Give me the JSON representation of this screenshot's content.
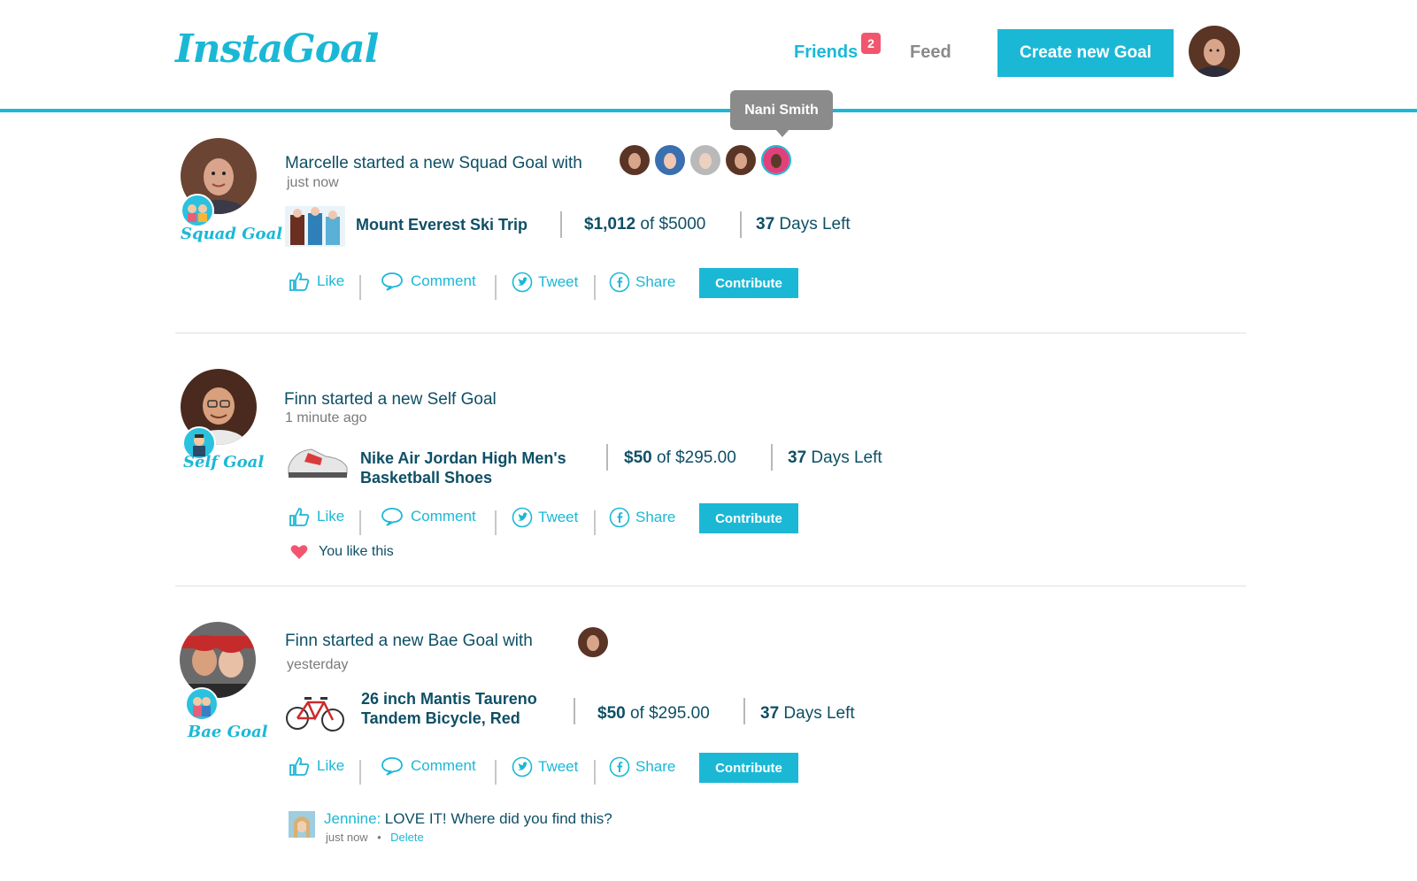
{
  "app": {
    "logo": "InstaGoal"
  },
  "nav": {
    "friends_label": "Friends",
    "friends_badge": "2",
    "feed_label": "Feed",
    "create_label": "Create new Goal",
    "tooltip_name": "Nani Smith"
  },
  "colors": {
    "accent": "#1bb8d6",
    "badge": "#f2566f",
    "text": "#0e4f66",
    "muted": "#7a7a7a"
  },
  "actions": {
    "like": "Like",
    "comment": "Comment",
    "tweet": "Tweet",
    "share": "Share",
    "contribute": "Contribute"
  },
  "posts": [
    {
      "title": "Marcelle started a new Squad Goal with",
      "time": "just now",
      "type_label": "Squad Goal",
      "goal_name": "Mount Everest Ski Trip",
      "raised": "$1,012",
      "of_text": "of $5000",
      "days": "37",
      "days_label": "Days Left"
    },
    {
      "title": "Finn started a new Self Goal",
      "time": "1 minute ago",
      "type_label": "Self Goal",
      "goal_name_line1": "Nike Air Jordan High Men's",
      "goal_name_line2": "Basketball Shoes",
      "raised": "$50",
      "of_text": "of $295.00",
      "days": "37",
      "days_label": "Days Left",
      "liked_text": "You like this"
    },
    {
      "title": "Finn started a new Bae Goal with",
      "time": "yesterday",
      "type_label": "Bae Goal",
      "goal_name_line1": "26 inch Mantis Taureno",
      "goal_name_line2": "Tandem Bicycle, Red",
      "raised": "$50",
      "of_text": "of $295.00",
      "days": "37",
      "days_label": "Days Left",
      "comment": {
        "author": "Jennine:",
        "text": "LOVE IT! Where did you find this?",
        "time": "just now",
        "delete_label": "Delete"
      }
    }
  ]
}
